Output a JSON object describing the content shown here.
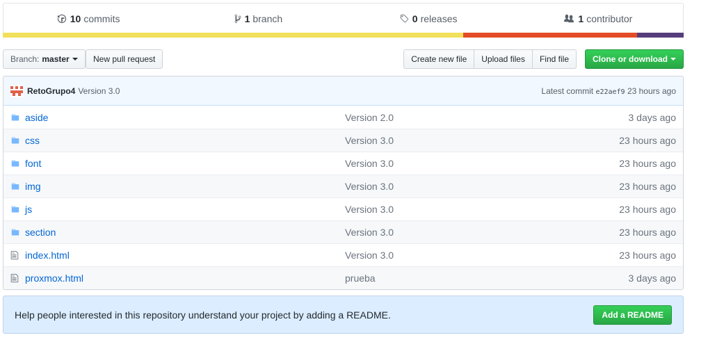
{
  "summary": {
    "commits": {
      "count": "10",
      "label": "commits",
      "icon": "history-icon"
    },
    "branches": {
      "count": "1",
      "label": "branch",
      "icon": "branch-icon"
    },
    "releases": {
      "count": "0",
      "label": "releases",
      "icon": "tag-icon"
    },
    "contributors": {
      "count": "1",
      "label": "contributor",
      "icon": "people-icon"
    },
    "languages": [
      {
        "color": "#f1e05a",
        "percent": 67.6
      },
      {
        "color": "#e34c26",
        "percent": 25.6
      },
      {
        "color": "#563d7c",
        "percent": 6.8
      }
    ]
  },
  "toolbar": {
    "branch_label": "Branch:",
    "branch_value": "master",
    "new_pr": "New pull request",
    "create_file": "Create new file",
    "upload_files": "Upload files",
    "find_file": "Find file",
    "clone": "Clone or download"
  },
  "commit": {
    "author": "RetoGrupo4",
    "message": "Version 3.0",
    "latest_label": "Latest commit",
    "sha": "e22aef9",
    "age": "23 hours ago"
  },
  "files": [
    {
      "name": "aside",
      "type": "dir",
      "message": "Version 2.0",
      "age": "3 days ago"
    },
    {
      "name": "css",
      "type": "dir",
      "message": "Version 3.0",
      "age": "23 hours ago"
    },
    {
      "name": "font",
      "type": "dir",
      "message": "Version 3.0",
      "age": "23 hours ago"
    },
    {
      "name": "img",
      "type": "dir",
      "message": "Version 3.0",
      "age": "23 hours ago"
    },
    {
      "name": "js",
      "type": "dir",
      "message": "Version 3.0",
      "age": "23 hours ago"
    },
    {
      "name": "section",
      "type": "dir",
      "message": "Version 3.0",
      "age": "23 hours ago"
    },
    {
      "name": "index.html",
      "type": "file",
      "message": "Version 3.0",
      "age": "23 hours ago"
    },
    {
      "name": "proxmox.html",
      "type": "file",
      "message": "prueba",
      "age": "3 days ago"
    }
  ],
  "readme": {
    "text": "Help people interested in this repository understand your project by adding a README.",
    "button": "Add a README"
  }
}
